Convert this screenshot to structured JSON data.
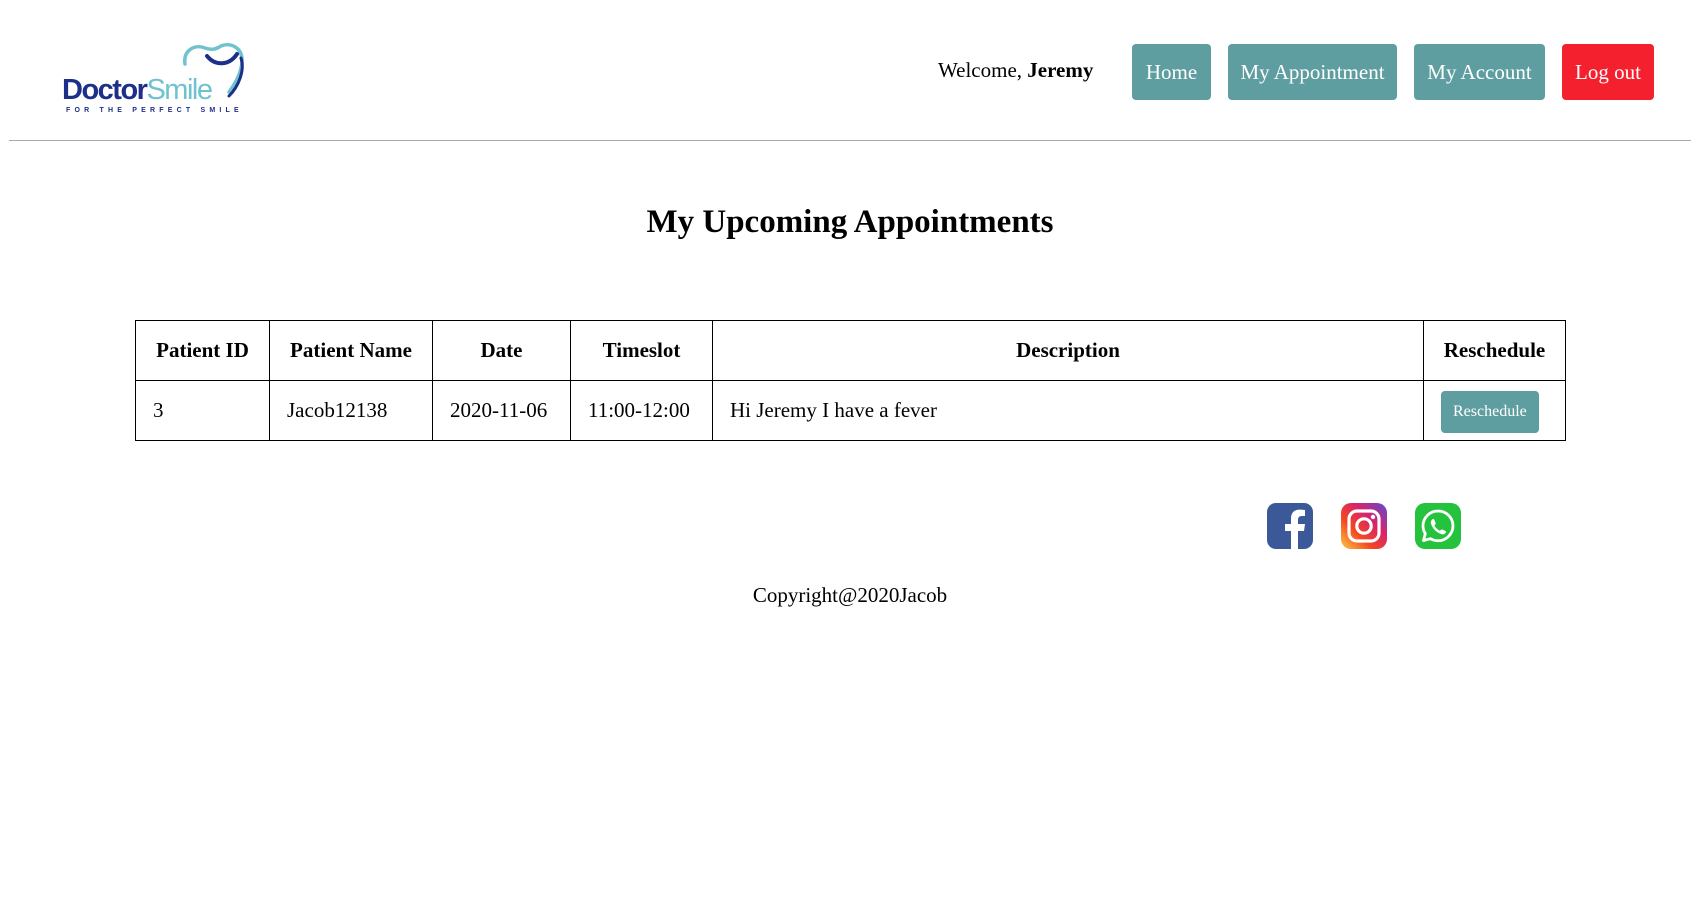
{
  "header": {
    "logo": {
      "brand_main": "Doctor",
      "brand_accent": "Smile",
      "tagline": "FOR THE PERFECT SMILE"
    },
    "welcome_prefix": "Welcome, ",
    "user_name": "Jeremy",
    "nav": {
      "home": "Home",
      "my_appointment": "My Appointment",
      "my_account": "My Account",
      "logout": "Log out"
    }
  },
  "main": {
    "title": "My Upcoming Appointments",
    "table": {
      "headers": [
        "Patient ID",
        "Patient Name",
        "Date",
        "Timeslot",
        "Description",
        "Reschedule"
      ],
      "rows": [
        {
          "patient_id": "3",
          "patient_name": "Jacob12138",
          "date": "2020-11-06",
          "timeslot": "11:00-12:00",
          "description": "Hi Jeremy I have a fever",
          "action": "Reschedule"
        }
      ]
    }
  },
  "footer": {
    "social": [
      "facebook-icon",
      "instagram-icon",
      "whatsapp-icon"
    ],
    "copyright": "Copyright@2020Jacob"
  },
  "colors": {
    "nav_button": "#5f9ea0",
    "logout_button": "#f4202e",
    "brand_dark": "#1e2f8a",
    "brand_light": "#6ec3cf"
  }
}
